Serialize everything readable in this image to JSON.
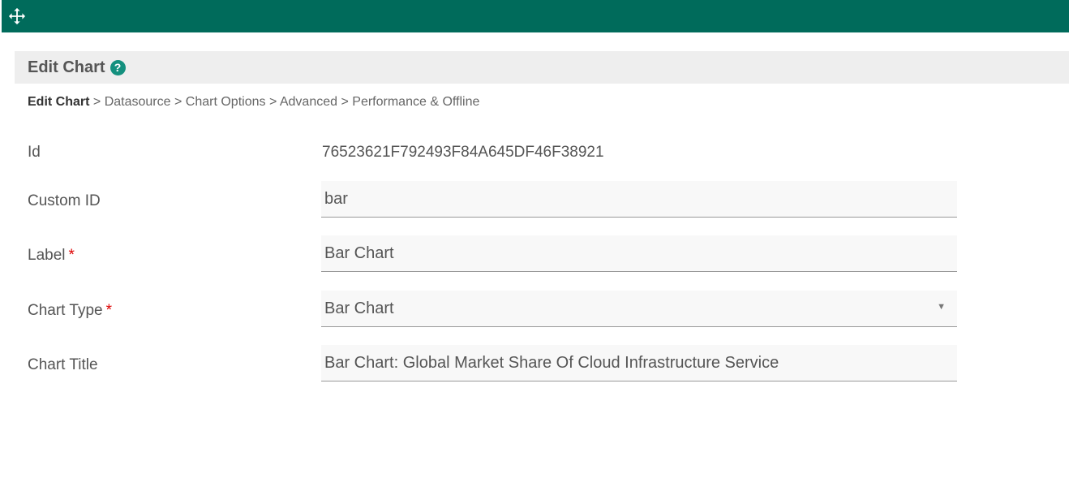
{
  "header": {
    "title": "Edit Chart"
  },
  "breadcrumb": [
    "Edit Chart",
    "Datasource",
    "Chart Options",
    "Advanced",
    "Performance & Offline"
  ],
  "breadcrumb_sep": ">",
  "fields": {
    "id": {
      "label": "Id",
      "value": "76523621F792493F84A645DF46F38921"
    },
    "custom_id": {
      "label": "Custom ID",
      "value": "bar"
    },
    "label": {
      "label": "Label",
      "value": "Bar Chart",
      "required": "*"
    },
    "chart_type": {
      "label": "Chart Type",
      "value": "Bar Chart",
      "required": "*"
    },
    "chart_title": {
      "label": "Chart Title",
      "value": "Bar Chart: Global Market Share Of Cloud Infrastructure Service"
    }
  },
  "help_glyph": "?",
  "caret_glyph": "▼",
  "colors": {
    "topbar": "#006b5b",
    "help": "#14907e"
  }
}
